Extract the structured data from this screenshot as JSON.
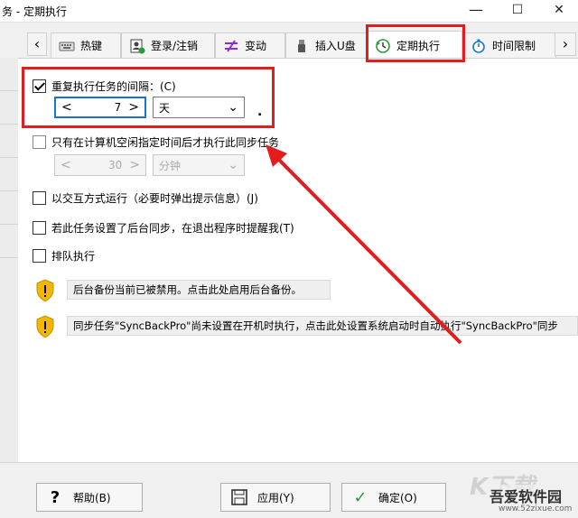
{
  "window": {
    "title": "务 - 定期执行",
    "minimize": "—",
    "maximize": "☐",
    "close": "✕"
  },
  "tabs": {
    "scroll_left": "‹",
    "scroll_right": "›",
    "items": [
      {
        "label": "热键",
        "icon": "keyboard-icon"
      },
      {
        "label": "登录/注销",
        "icon": "user-badge-icon"
      },
      {
        "label": "变动",
        "icon": "change-icon"
      },
      {
        "label": "插入U盘",
        "icon": "usb-icon"
      },
      {
        "label": "定期执行",
        "icon": "clock-refresh-icon",
        "active": true
      },
      {
        "label": "时间限制",
        "icon": "stopwatch-icon"
      }
    ]
  },
  "options": {
    "repeat": {
      "label": "重复执行任务的间隔：(C)",
      "checked": true,
      "value": "7",
      "unit": "天",
      "trailing": "."
    },
    "idle": {
      "label": "只有在计算机空闲指定时间后才执行此同步任务",
      "checked": false,
      "value": "30",
      "unit": "分钟"
    },
    "interactive": {
      "label": "以交互方式运行（必要时弹出提示信息）(J)",
      "checked": false
    },
    "remind": {
      "label": "若此任务设置了后台同步，在退出程序时提醒我(T)",
      "checked": false
    },
    "queue": {
      "label": "排队执行",
      "checked": false
    }
  },
  "notices": [
    {
      "text": "后台备份当前已被禁用。点击此处启用后台备份。",
      "icon": "warning-shield-icon"
    },
    {
      "text": "同步任务\"SyncBackPro\"尚未设置在开机时执行，点击此处设置系统启动时自动执行\"SyncBackPro\"同步",
      "icon": "warning-shield-icon"
    }
  ],
  "buttons": {
    "help": {
      "label": "帮助(B)",
      "icon": "?"
    },
    "apply": {
      "label": "应用(Y)",
      "icon": "save-icon"
    },
    "ok": {
      "label": "确定(O)",
      "icon": "✓"
    }
  },
  "watermark": {
    "text": "吾爱软件园",
    "url": "www.52zixue.com"
  },
  "colors": {
    "accent": "#1a73d9",
    "highlight": "#e31d1d",
    "shield": "#f2b705"
  }
}
